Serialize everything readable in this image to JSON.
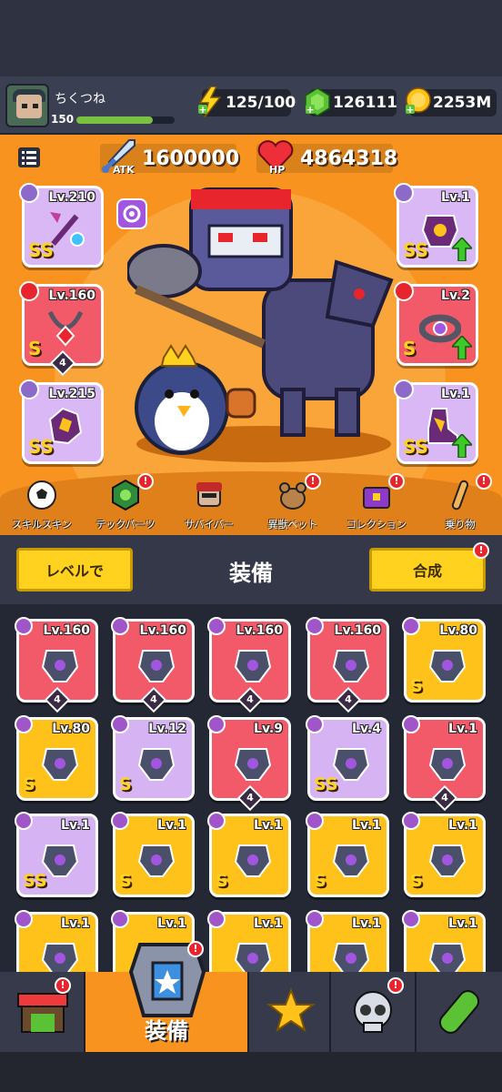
{
  "player": {
    "name": "ちくつね",
    "level": "150",
    "xp_fraction": 0.78
  },
  "resources": {
    "energy": "125/100",
    "gems": "126111",
    "gold": "2253M"
  },
  "stats": {
    "atk_label": "ATK",
    "atk_value": "1600000",
    "hp_label": "HP",
    "hp_value": "4864318"
  },
  "equipped": {
    "left": [
      {
        "level": "Lv.210",
        "rank": "SS",
        "color": "purple"
      },
      {
        "level": "Lv.160",
        "rank": "S",
        "color": "red",
        "stars": "4"
      },
      {
        "level": "Lv.215",
        "rank": "SS",
        "color": "purple"
      }
    ],
    "right": [
      {
        "level": "Lv.1",
        "rank": "SS",
        "color": "purple"
      },
      {
        "level": "Lv.2",
        "rank": "S",
        "color": "red"
      },
      {
        "level": "Lv.1",
        "rank": "SS",
        "color": "purple"
      }
    ]
  },
  "feature_tabs": [
    {
      "label": "スキルスキン"
    },
    {
      "label": "テックパーツ"
    },
    {
      "label": "サバイバー"
    },
    {
      "label": "異獣ペット"
    },
    {
      "label": "コレクション"
    },
    {
      "label": "乗り物"
    }
  ],
  "equipment_section": {
    "level_button": "レベルで",
    "title": "装備",
    "merge_button": "合成"
  },
  "inventory": [
    {
      "level": "Lv.160",
      "color": "red",
      "rank": "",
      "stars": "4"
    },
    {
      "level": "Lv.160",
      "color": "red",
      "rank": "",
      "stars": "4"
    },
    {
      "level": "Lv.160",
      "color": "red",
      "rank": "",
      "stars": "4"
    },
    {
      "level": "Lv.160",
      "color": "red",
      "rank": "",
      "stars": "4"
    },
    {
      "level": "Lv.80",
      "color": "yellow",
      "rank": "S",
      "stars": ""
    },
    {
      "level": "Lv.80",
      "color": "yellow",
      "rank": "S",
      "stars": ""
    },
    {
      "level": "Lv.12",
      "color": "purple",
      "rank": "S",
      "stars": ""
    },
    {
      "level": "Lv.9",
      "color": "red",
      "rank": "",
      "stars": "4"
    },
    {
      "level": "Lv.4",
      "color": "purple",
      "rank": "SS",
      "stars": ""
    },
    {
      "level": "Lv.1",
      "color": "red",
      "rank": "",
      "stars": "4"
    },
    {
      "level": "Lv.1",
      "color": "purple",
      "rank": "SS",
      "stars": ""
    },
    {
      "level": "Lv.1",
      "color": "yellow",
      "rank": "S",
      "stars": ""
    },
    {
      "level": "Lv.1",
      "color": "yellow",
      "rank": "S",
      "stars": ""
    },
    {
      "level": "Lv.1",
      "color": "yellow",
      "rank": "S",
      "stars": ""
    },
    {
      "level": "Lv.1",
      "color": "yellow",
      "rank": "S",
      "stars": ""
    },
    {
      "level": "Lv.1",
      "color": "yellow",
      "rank": "",
      "stars": ""
    },
    {
      "level": "Lv.1",
      "color": "yellow",
      "rank": "",
      "stars": ""
    },
    {
      "level": "Lv.1",
      "color": "yellow",
      "rank": "",
      "stars": ""
    },
    {
      "level": "Lv.1",
      "color": "yellow",
      "rank": "",
      "stars": ""
    },
    {
      "level": "Lv.1",
      "color": "yellow",
      "rank": "",
      "stars": ""
    }
  ],
  "bottom_nav": {
    "equip_label": "装備"
  }
}
